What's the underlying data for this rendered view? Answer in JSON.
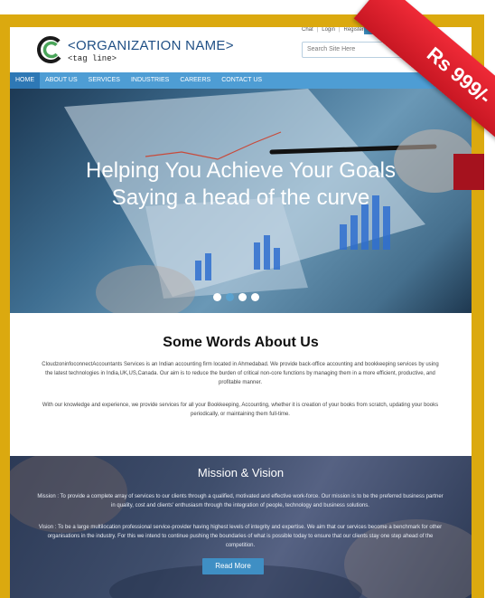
{
  "brand": {
    "name": "<ORGANIZATION NAME>",
    "tagline": "<tag line>",
    "logo_letter": "C",
    "color_primary": "#1f4f85",
    "color_accent": "#4e9dd4",
    "logo_icon": "double-c-logo-icon"
  },
  "top_links": {
    "chat": "Chat",
    "login": "Login",
    "register": "Register"
  },
  "search": {
    "placeholder": "Search Site Here"
  },
  "nav": [
    {
      "label": "HOME",
      "active": true
    },
    {
      "label": "ABOUT US",
      "active": false
    },
    {
      "label": "SERVICES",
      "active": false
    },
    {
      "label": "INDUSTRIES",
      "active": false
    },
    {
      "label": "CAREERS",
      "active": false
    },
    {
      "label": "CONTACT US",
      "active": false
    }
  ],
  "hero": {
    "line1": "Helping You Achieve Your Goals",
    "line2": "Saying a head of the curve",
    "slide_count": 4,
    "active_slide": 2
  },
  "about": {
    "title": "Some Words About Us",
    "paragraph1": "CloudzoninfoconnectAccountants Services is an Indian accounting firm located in Ahmedabad. We provide back-office accounting and bookkeeping services by using the latest technologies in India,UK,US,Canada. Our aim is to reduce the burden of critical non-core functions by managing them in a more efficient, productive, and profitable manner.",
    "paragraph2": "With our knowledge and experience, we provide services for all your Bookkeeping, Accounting, whether it is creation of your books from scratch, updating your books periodically, or maintaining them full-time."
  },
  "mission": {
    "title": "Mission & Vision",
    "mission_text": "Mission : To provide a complete array of services to our clients through a qualified, motivated and effective work-force. Our mission is to be the preferred business partner in quality, cost and clients' enthusiasm through the integration of people, technology and business solutions.",
    "vision_text": "Vision : To be a large multilocation professional service-provider having highest levels of integrity and expertise. We aim that our services become a benchmark for other organisations in the industry. For this we intend to continue pushing the boundaries of what is possible today to ensure that our clients stay one step ahead of the competition.",
    "button_label": "Read More"
  },
  "price_ribbon": {
    "label": "Rs 999/-",
    "color": "#e02230"
  },
  "frame_color": "#dba90f"
}
